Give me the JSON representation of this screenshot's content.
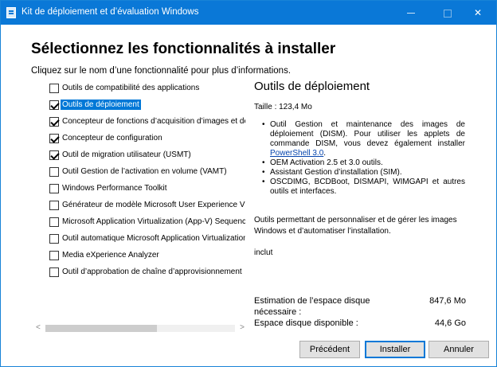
{
  "window": {
    "title": "Kit de déploiement et d’évaluation Windows",
    "controls": {
      "minimize": "",
      "maximize": "",
      "close": "✕"
    }
  },
  "page": {
    "heading": "Sélectionnez les fonctionnalités à installer",
    "subheading": "Cliquez sur le nom d’une fonctionnalité pour plus d’informations."
  },
  "features": [
    {
      "label": "Outils de compatibilité des applications",
      "checked": false,
      "selected": false
    },
    {
      "label": "Outils de déploiement",
      "checked": true,
      "selected": true
    },
    {
      "label": "Concepteur de fonctions d’acquisition d’images et de cc",
      "checked": true,
      "selected": false
    },
    {
      "label": "Concepteur de configuration",
      "checked": true,
      "selected": false
    },
    {
      "label": "Outil de migration utilisateur (USMT)",
      "checked": true,
      "selected": false
    },
    {
      "label": "Outil Gestion de l’activation en volume (VAMT)",
      "checked": false,
      "selected": false
    },
    {
      "label": "Windows Performance Toolkit",
      "checked": false,
      "selected": false
    },
    {
      "label": "Générateur de modèle Microsoft User Experience Virtua",
      "checked": false,
      "selected": false
    },
    {
      "label": "Microsoft Application Virtualization (App-V) Sequencer",
      "checked": false,
      "selected": false
    },
    {
      "label": "Outil automatique Microsoft Application Virtualization (A",
      "checked": false,
      "selected": false
    },
    {
      "label": "Media eXperience Analyzer",
      "checked": false,
      "selected": false
    },
    {
      "label": "Outil d’approbation de chaîne d’approvisionnement",
      "checked": false,
      "selected": false
    }
  ],
  "details": {
    "title": "Outils de déploiement",
    "size": "Taille : 123,4 Mo",
    "bullet1_text": "Outil Gestion et maintenance des images de déploiement (DISM). Pour utiliser les applets de commande DISM, vous devez également installer ",
    "bullet1_link": "PowerShell 3.0",
    "bullet1_end": ".",
    "bullet2": "OEM Activation 2.5 et 3.0 outils.",
    "bullet3": "Assistant Gestion d’installation (SIM).",
    "bullet4": "OSCDIMG, BCDBoot, DISMAPI, WIMGAPI et autres outils et interfaces.",
    "description": "Outils permettant de personnaliser et de gérer les images Windows et d’automatiser l’installation.",
    "status": "inclut"
  },
  "space": {
    "required_label": "Estimation de l’espace disque nécessaire :",
    "required_value": "847,6 Mo",
    "available_label": "Espace disque disponible :",
    "available_value": "44,6 Go"
  },
  "scrollbar": {
    "left_arrow": "<",
    "right_arrow": ">",
    "position_fraction": 0.0
  },
  "buttons": {
    "previous": "Précédent",
    "install": "Installer",
    "cancel": "Annuler"
  }
}
